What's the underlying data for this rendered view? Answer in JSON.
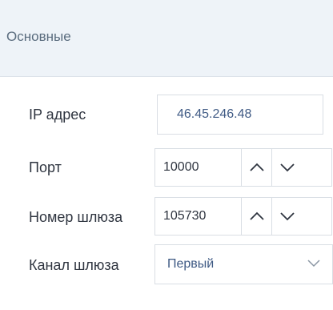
{
  "section": {
    "title": "Основные"
  },
  "fields": {
    "ip": {
      "label": "IP адрес",
      "value": "46.45.246.48"
    },
    "port": {
      "label": "Порт",
      "value": "10000"
    },
    "gateway_number": {
      "label": "Номер шлюза",
      "value": "105730"
    },
    "gateway_channel": {
      "label": "Канал шлюза",
      "selected": "Первый"
    }
  },
  "icons": {
    "increment": "chevron-up-icon",
    "decrement": "chevron-down-icon",
    "dropdown": "chevron-down-icon"
  },
  "colors": {
    "header_bg": "#eef3f8",
    "accent_text": "#3f5a84",
    "border": "#d9dee4"
  }
}
